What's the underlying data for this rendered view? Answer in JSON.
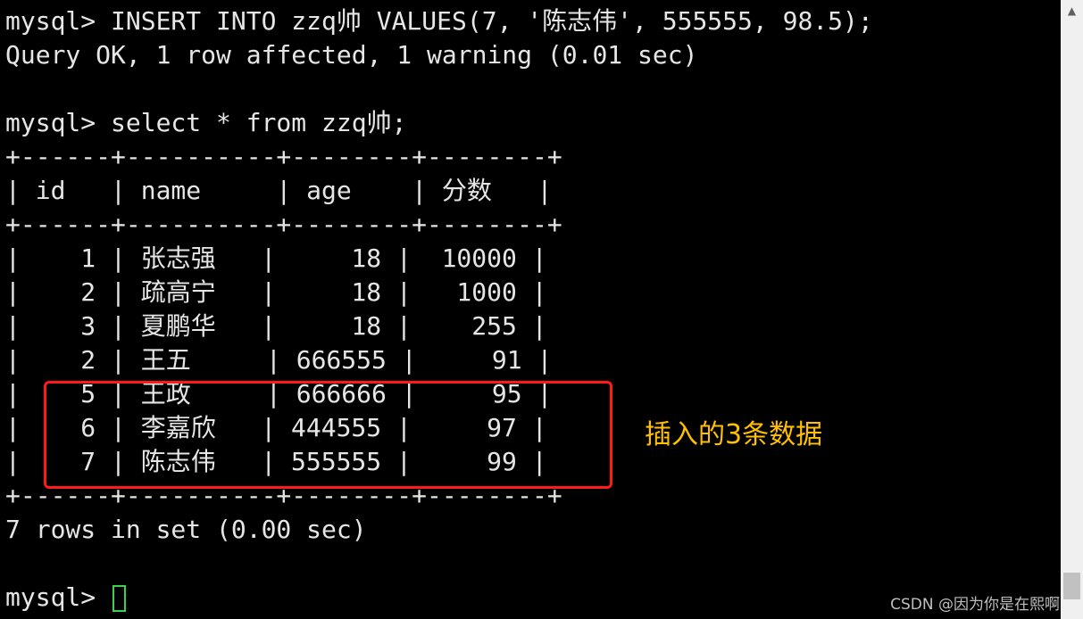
{
  "terminal": {
    "lines": [
      "mysql> INSERT INTO zzq帅 VALUES(7, '陈志伟', 555555, 98.5);",
      "Query OK, 1 row affected, 1 warning (0.01 sec)",
      "",
      "mysql> select * from zzq帅;",
      "+------+----------+--------+--------+",
      "| id   | name     | age    | 分数   |",
      "+------+----------+--------+--------+",
      "|    1 | 张志强   |     18 |  10000 |",
      "|    2 | 疏高宁   |     18 |   1000 |",
      "|    3 | 夏鹏华   |     18 |    255 |",
      "|    2 | 王五     | 666555 |     91 |",
      "|    5 | 王政     | 666666 |     95 |",
      "|    6 | 李嘉欣   | 444555 |     97 |",
      "|    7 | 陈志伟   | 555555 |     99 |",
      "+------+----------+--------+--------+",
      "7 rows in set (0.00 sec)",
      ""
    ],
    "prompt": "mysql> "
  },
  "annotation": {
    "text": "插入的3条数据",
    "color": "#ffc000",
    "box_color": "#ff1a1a"
  },
  "watermark": "CSDN @因为你是在熙啊",
  "colors": {
    "background": "#000000",
    "text": "#e6e6e6",
    "cursor": "#3cd14a"
  },
  "scrollbar": {
    "up_arrow_icon": "triangle-up-icon"
  }
}
